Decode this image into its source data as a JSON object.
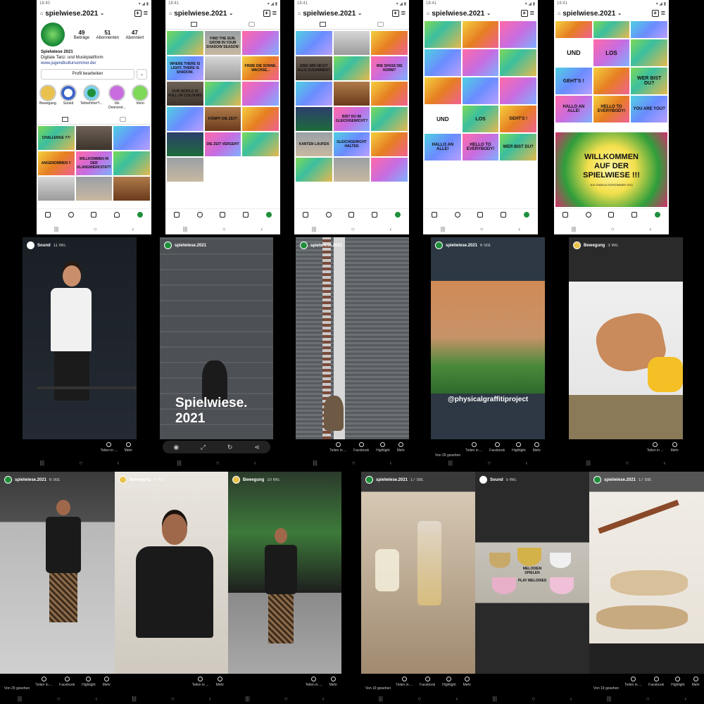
{
  "account": "spielwiese.2021",
  "profile": {
    "posts_count": "49",
    "posts_label": "Beiträge",
    "followers_count": "51",
    "followers_label": "Abonnenten",
    "following_count": "47",
    "following_label": "Abonniert",
    "name": "Spielwiese 2021",
    "bio": "Digitale Tanz- und Musikplattform",
    "link": "www.jugendkultursommer.de/",
    "edit_button": "Profil bearbeiten",
    "highlights": [
      "Bewegung",
      "Sound",
      "Teilnehmer*i...",
      "bis Donnerst...",
      "Verei"
    ]
  },
  "status_times": [
    "18:40",
    "18:41",
    "18:41",
    "18:41",
    "18:41"
  ],
  "profile_tiles": [
    {
      "text": "CHALLENGE ??!",
      "style": "g1"
    },
    {
      "text": "",
      "style": "ph2"
    },
    {
      "text": "",
      "style": "g3"
    },
    {
      "text": "ANGENOMMEN !!",
      "style": "g4"
    },
    {
      "text": "WILLKOMMEN IN DER KLANGWERKSTATT",
      "style": "g2"
    },
    {
      "text": "",
      "style": "g1"
    },
    {
      "text": "",
      "style": "ph4"
    },
    {
      "text": "",
      "style": "ph1"
    },
    {
      "text": "",
      "style": "ph5"
    }
  ],
  "feed2_tiles": [
    "",
    "FIND THE SUN. GROW IN YOUR SHADOW SEASON!",
    "",
    "WHERE THERE IS LIGHT, THERE IS SHADOW.",
    "",
    "FINDE DIE SONNE. WACHSE...",
    "OUR WORLD IS FULL OF COLOURS",
    "",
    "",
    "",
    "KÄMPF DIE ZEIT!",
    "",
    "",
    "DIE ZEIT VERGEHT",
    "",
    ""
  ],
  "feed3_tiles": [
    "",
    "",
    "",
    "SIND WIR NICHT ALLE ZUSAMMEN?",
    "",
    "WIE SPASS DIE NORM?",
    "",
    "",
    "",
    "",
    "BIST DU IM GLEICHGEWICHT?",
    "",
    "KANTEN LAUFEN",
    "GLEICHGEWICHT HALTEN",
    "",
    "",
    "",
    ""
  ],
  "feed4_tiles": [
    "",
    "",
    "",
    "",
    "",
    "",
    "",
    "",
    "",
    "",
    "",
    "",
    ""
  ],
  "feed4_words": {
    "und": "UND",
    "los": "LOS",
    "gehts": "GEHT'S !",
    "hallo": "HALLO AN ALLE!",
    "hello": "HELLO TO EVERYBODY!",
    "who": "WER BIST DU?",
    "you": "YOU ARE YOU?"
  },
  "feed5": {
    "welcome": "WILLKOMMEN AUF DER SPIELWIESE !!!",
    "subtitle": "JUG ENDKULTURSOMMER 2021"
  },
  "stories": [
    {
      "user": "Sound",
      "ago": "11 Wo."
    },
    {
      "user": "spielwiese.2021",
      "ago": "",
      "overlay": "Spielwiese. 2021"
    },
    {
      "user": "spielwiese.2021",
      "ago": ""
    },
    {
      "user": "spielwiese.2021",
      "ago": "6 Std.",
      "tag": "@physicalgraffitiproject",
      "views": "Von 29 gesehen"
    },
    {
      "user": "Bewegung",
      "ago": "3 Wo."
    },
    {
      "user": "spielwiese.2021",
      "ago": "6 Std.",
      "views": "Von 29 gesehen"
    },
    {
      "user": "Bewegung",
      "ago": "4 Wo."
    },
    {
      "user": "Bewegung",
      "ago": "10 Wo."
    },
    {
      "user": "spielwiese.2021",
      "ago": "17 Std.",
      "views": "Von 19 gesehen"
    },
    {
      "user": "Sound",
      "ago": "5 Wo.",
      "overlay": "MELODIEN SPIELEN",
      "overlay2": "PLAY MELODIES"
    },
    {
      "user": "spielwiese.2021",
      "ago": "17 Std.",
      "views": "Von 19 gesehen"
    }
  ],
  "story_actions": {
    "share": "Teilen in ...",
    "more": "Mehr",
    "facebook": "Facebook",
    "highlight": "Highlight"
  },
  "colors": {
    "ig_green": "#1f8f3a",
    "highlight_gold": "#e9c14d"
  }
}
